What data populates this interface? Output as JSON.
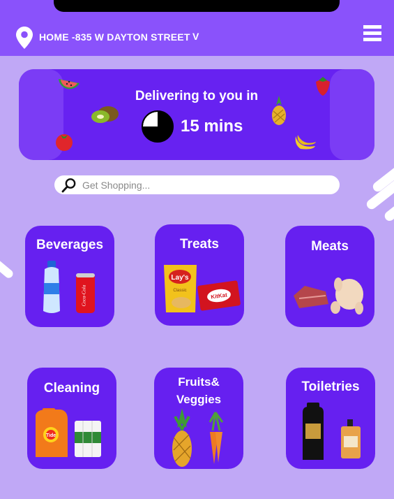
{
  "header": {
    "address": "HOME -835 W DAYTON STREET",
    "dropdown": "V",
    "icons": {
      "location": "location-pin-icon",
      "menu": "hamburger-menu-icon"
    }
  },
  "banner": {
    "line1": "Delivering to you in",
    "eta": "15 mins",
    "eta_progress": 0.75
  },
  "search": {
    "placeholder": "Get Shopping..."
  },
  "categories": [
    {
      "label": "Beverages"
    },
    {
      "label": "Treats"
    },
    {
      "label": "Meats"
    },
    {
      "label": "Cleaning"
    },
    {
      "label": "Fruits&",
      "label2": "Veggies"
    },
    {
      "label": "Toiletries"
    }
  ],
  "product_text": {
    "lays": "Lay's",
    "lays_flavor": "Classic",
    "kitkat": "KitKat",
    "coke": "Coca-Cola",
    "tide": "Tide"
  },
  "colors": {
    "header": "#8a52fb",
    "background": "#c0a8f6",
    "card": "#6620f0",
    "banner": "#6722f1"
  }
}
